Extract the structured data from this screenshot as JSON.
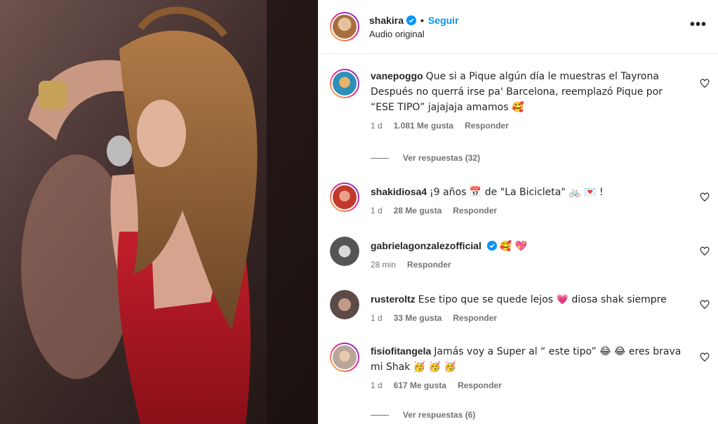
{
  "header": {
    "username": "shakira",
    "separator": "•",
    "follow_label": "Seguir",
    "subtitle": "Audio original",
    "more": "•••"
  },
  "comments": [
    {
      "user": "vanepoggo",
      "text": "Que si a Pique algún día le muestras el Tayrona Después no querrá irse pa' Barcelona, reemplazó Pique por “ESE TIPO” jajajaja amamos 🥰",
      "time": "1 d",
      "likes": "1.081 Me gusta",
      "reply": "Responder",
      "replies_label": "Ver respuestas (32)"
    },
    {
      "user": "shakidiosa4",
      "text": "¡9 años 📅 de \"La Bicicleta\" 🚲 💌 !",
      "time": "1 d",
      "likes": "28 Me gusta",
      "reply": "Responder"
    },
    {
      "user": "gabrielagonzalezofficial",
      "text": "🥰 💖",
      "time": "28 min",
      "reply": "Responder"
    },
    {
      "user": "rusteroltz",
      "text": "Ese tipo que se quede lejos 💗  diosa shak siempre",
      "time": "1 d",
      "likes": "33 Me gusta",
      "reply": "Responder"
    },
    {
      "user": "fisiofitangela",
      "text": "Jamás voy a Super al “ este tipo” 😂 😂  eres brava mi Shak 🥳 🥳 🥳",
      "time": "1 d",
      "likes": "617 Me gusta",
      "reply": "Responder",
      "replies_label": "Ver respuestas (6)"
    }
  ],
  "colors": {
    "accent": "#0095f6",
    "verified": "#0095f6",
    "muted": "#737373",
    "text": "#262626"
  }
}
